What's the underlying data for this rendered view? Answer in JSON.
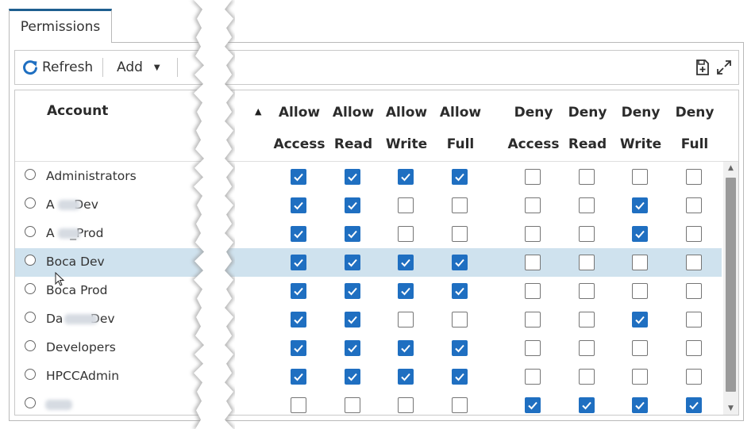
{
  "tab": {
    "label": "Permissions"
  },
  "toolbar": {
    "refresh_label": "Refresh",
    "add_label": "Add",
    "refresh_icon": "refresh-icon",
    "add_dropdown_icon": "caret-down-icon",
    "save_icon": "save-add-icon",
    "fullscreen_icon": "expand-icon"
  },
  "columns": {
    "account": "Account",
    "permission_cols": [
      {
        "line1": "Allow",
        "line2": "Access"
      },
      {
        "line1": "Allow",
        "line2": "Read"
      },
      {
        "line1": "Allow",
        "line2": "Write"
      },
      {
        "line1": "Allow",
        "line2": "Full"
      },
      {
        "line1": "Deny",
        "line2": "Access"
      },
      {
        "line1": "Deny",
        "line2": "Read"
      },
      {
        "line1": "Deny",
        "line2": "Write"
      },
      {
        "line1": "Deny",
        "line2": "Full"
      }
    ]
  },
  "rows": [
    {
      "name": "Administrators",
      "selected": false,
      "perms": [
        true,
        true,
        true,
        true,
        false,
        false,
        false,
        false
      ]
    },
    {
      "name": "A     Dev",
      "selected": false,
      "perms": [
        true,
        true,
        false,
        false,
        false,
        false,
        true,
        false
      ]
    },
    {
      "name": "A    _Prod",
      "selected": false,
      "perms": [
        true,
        true,
        false,
        false,
        false,
        false,
        true,
        false
      ]
    },
    {
      "name": "Boca Dev",
      "selected": true,
      "perms": [
        true,
        true,
        true,
        true,
        false,
        false,
        false,
        false
      ]
    },
    {
      "name": "Boca Prod",
      "selected": false,
      "perms": [
        true,
        true,
        true,
        true,
        false,
        false,
        false,
        false
      ]
    },
    {
      "name": "Da       Dev",
      "selected": false,
      "perms": [
        true,
        true,
        false,
        false,
        false,
        false,
        true,
        false
      ]
    },
    {
      "name": "Developers",
      "selected": false,
      "perms": [
        true,
        true,
        true,
        true,
        false,
        false,
        false,
        false
      ]
    },
    {
      "name": "HPCCAdmin",
      "selected": false,
      "perms": [
        true,
        true,
        true,
        true,
        false,
        false,
        false,
        false
      ]
    },
    {
      "name": "",
      "selected": false,
      "perms": [
        false,
        false,
        false,
        false,
        true,
        true,
        true,
        true
      ]
    }
  ],
  "colors": {
    "accent": "#1f6fc1",
    "selected_row": "#cfe2ee",
    "tab_border": "#1e5f8f"
  }
}
